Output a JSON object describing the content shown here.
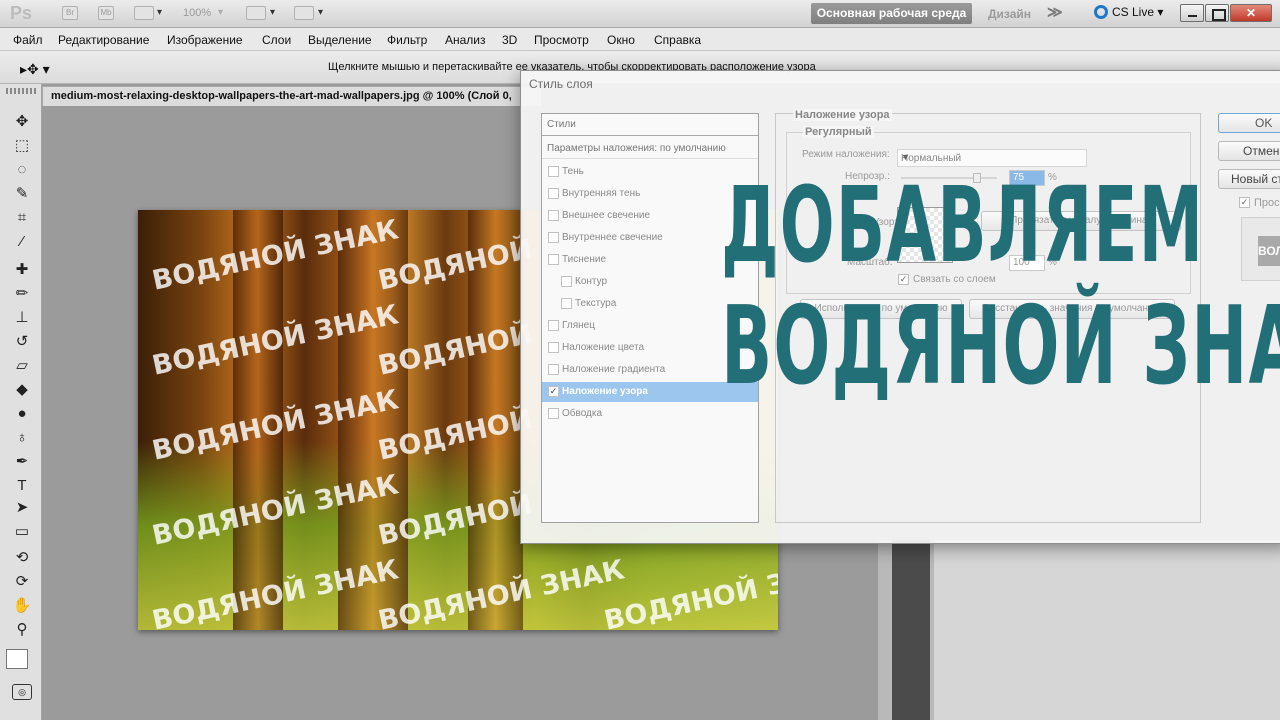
{
  "appbar": {
    "logo": "Ps",
    "mini_br": "Br",
    "mini_mb": "Mb",
    "zoom": "100%",
    "workspace_active": "Основная рабочая среда",
    "workspace_design": "Дизайн",
    "more": "≫",
    "cs_live": "CS Live ▾",
    "close": "✕"
  },
  "menu": [
    "Файл",
    "Редактирование",
    "Изображение",
    "Слои",
    "Выделение",
    "Фильтр",
    "Анализ",
    "3D",
    "Просмотр",
    "Окно",
    "Справка"
  ],
  "options": {
    "hint": "Щелкните мышью и перетаскивайте ее указатель, чтобы скорректировать расположение узора"
  },
  "document": {
    "tab_title": "medium-most-relaxing-desktop-wallpapers-the-art-mad-wallpapers.jpg @ 100% (Слой 0,"
  },
  "watermark": {
    "text": "ВОДЯНОЙ ЗНАК"
  },
  "dialog": {
    "title": "Стиль слоя",
    "styles_header": "Стили",
    "blend_params": "Параметры наложения: по умолчанию",
    "styles": [
      {
        "label": "Тень",
        "checked": false
      },
      {
        "label": "Внутренняя тень",
        "checked": false
      },
      {
        "label": "Внешнее свечение",
        "checked": false
      },
      {
        "label": "Внутреннее свечение",
        "checked": false
      },
      {
        "label": "Тиснение",
        "checked": false
      },
      {
        "label": "Контур",
        "checked": false
      },
      {
        "label": "Текстура",
        "checked": false
      },
      {
        "label": "Глянец",
        "checked": false
      },
      {
        "label": "Наложение цвета",
        "checked": false
      },
      {
        "label": "Наложение градиента",
        "checked": false
      },
      {
        "label": "Наложение узора",
        "checked": true
      },
      {
        "label": "Обводка",
        "checked": false
      }
    ],
    "section_title": "Наложение узора",
    "subsection_title": "Регулярный",
    "blend_mode_label": "Режим наложения:",
    "blend_mode_value": "Нормальный",
    "opacity_label": "Непрозр.:",
    "opacity_value": "75",
    "opacity_level": 0.75,
    "percent": "%",
    "pattern_label": "Узор:",
    "snap_button": "Привязать к началу координат",
    "scale_label": "Масштаб:",
    "scale_value": "100",
    "link_label": "Связать со слоем",
    "use_default_button": "Использовать по умолчанию",
    "reset_default_button": "Восстановить значения по умолчанию",
    "ok_button": "OK",
    "cancel_button": "Отмена",
    "new_style_button": "Новый стиль...",
    "preview_label": "Просмотр",
    "preview_thumb": "ВОЛ"
  },
  "headline": {
    "line1": "ДОБАВЛЯЕМ",
    "line2": "ВОДЯНОЙ ЗНАК",
    "color": "#236f77"
  }
}
